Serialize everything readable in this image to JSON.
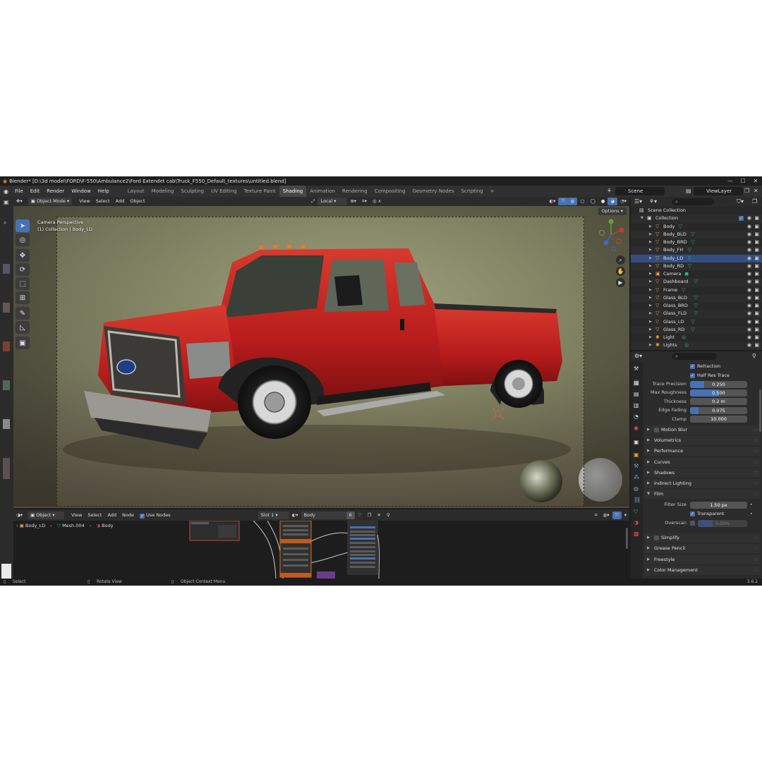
{
  "titlebar": {
    "title": "Blender* [D:\\3d model\\FORD\\F-550\\Ambulance2\\Ford Extendet cab\\Truck_F550_Default_textures\\untitled.blend]",
    "minimize": "—",
    "maximize": "☐",
    "close": "✕"
  },
  "menu": [
    "File",
    "Edit",
    "Render",
    "Window",
    "Help"
  ],
  "workspaces": [
    "Layout",
    "Modeling",
    "Sculpting",
    "UV Editing",
    "Texture Paint",
    "Shading",
    "Animation",
    "Rendering",
    "Compositing",
    "Geometry Nodes",
    "Scripting",
    "+"
  ],
  "active_workspace": "Shading",
  "scene": "Scene",
  "view_layer": "ViewLayer",
  "viewport": {
    "mode": "Object Mode",
    "menus": [
      "View",
      "Select",
      "Add",
      "Object"
    ],
    "orientation": "Local",
    "options": "Options",
    "overlay_line1": "Camera Perspective",
    "overlay_line2": "(1) Collection | Body_LD"
  },
  "node_editor": {
    "editor_type": "Object",
    "menus": [
      "View",
      "Select",
      "Add",
      "Node"
    ],
    "use_nodes": "Use Nodes",
    "slot": "Slot 1",
    "material": "Body",
    "users": "6",
    "breadcrumb": [
      "Body_LD",
      "Mesh.004",
      "Body"
    ]
  },
  "statusbar": {
    "select": "Select",
    "rotate": "Rotate View",
    "context": "Object Context Menu",
    "version": "3.6.2"
  },
  "outliner": {
    "scene_collection": "Scene Collection",
    "collection": "Collection",
    "items": [
      "Body",
      "Body_BLD",
      "Body_BRD",
      "Body_FH",
      "Body_LD",
      "Body_RD",
      "Camera",
      "Dashboard",
      "Frame",
      "Glass_BLD",
      "Glass_BRD",
      "Glass_FLD",
      "Glass_LD",
      "Glass_RD",
      "Light",
      "Lights"
    ]
  },
  "properties": {
    "refraction": "Refraction",
    "half_res_trace": "Half Res Trace",
    "fields": [
      {
        "label": "Trace Precision",
        "value": "0.250",
        "fraction": 0.25
      },
      {
        "label": "Max Roughness",
        "value": "0.500",
        "fraction": 0.5
      },
      {
        "label": "Thickness",
        "value": "0.2 m",
        "fraction": 0
      },
      {
        "label": "Edge Fading",
        "value": "0.075",
        "fraction": 0.15
      },
      {
        "label": "Clamp",
        "value": "10.000",
        "fraction": 0
      }
    ],
    "panels_a": [
      "Motion Blur",
      "Volumetrics",
      "Performance",
      "Curves",
      "Shadows",
      "Indirect Lighting"
    ],
    "film": "Film",
    "filter_size_label": "Filter Size",
    "filter_size": "1.50 px",
    "transparent": "Transparent",
    "overscan_label": "Overscan",
    "overscan": "3.00%",
    "panels_b": [
      "Simplify",
      "Grease Pencil",
      "Freestyle",
      "Color Management"
    ]
  },
  "colors": {
    "accent": "#4772b3",
    "truck_red": "#c41f1f",
    "object_orange": "#ff9c39",
    "mesh_green": "#1fb885"
  }
}
